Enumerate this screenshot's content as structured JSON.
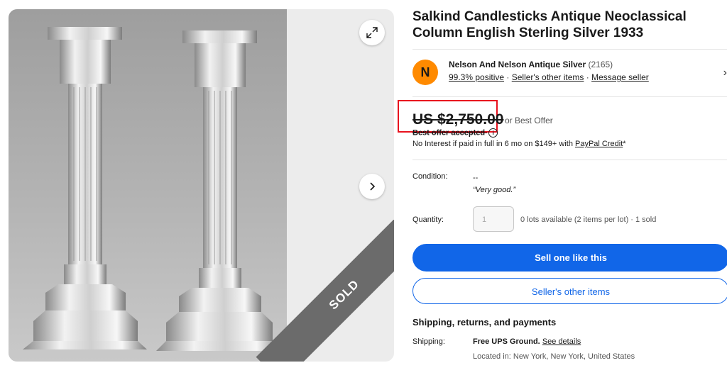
{
  "listing": {
    "title": "Salkind Candlesticks Antique Neoclassical Column English Sterling Silver 1933",
    "sold_badge": "SOLD"
  },
  "seller": {
    "avatar_initial": "N",
    "name": "Nelson And Nelson Antique Silver",
    "feedback_count": "(2165)",
    "positive": "99.3% positive",
    "other_items_link": "Seller's other items",
    "message_link": "Message seller",
    "separator": "·"
  },
  "price": {
    "amount": "US $2,750.00",
    "best_offer": "or Best Offer",
    "offer_accepted": "Best offer accepted",
    "financing_text": "No Interest if paid in full in 6 mo on $149+ with",
    "financing_link": "PayPal Credit",
    "financing_suffix": "*"
  },
  "condition": {
    "label": "Condition:",
    "value": "--",
    "note": "“Very good.”"
  },
  "quantity": {
    "label": "Quantity:",
    "value": "1",
    "availability": "0 lots available (2 items per lot) · 1 sold"
  },
  "actions": {
    "primary": "Sell one like this",
    "secondary": "Seller's other items"
  },
  "shipping": {
    "heading": "Shipping, returns, and payments",
    "label": "Shipping:",
    "method": "Free UPS Ground.",
    "details_link": "See details",
    "location": "Located in: New York, New York, United States"
  },
  "icons": {
    "expand": "expand-icon",
    "next": "chevron-right-icon",
    "seller_chevron": "chevron-right-icon",
    "info": "info-icon"
  },
  "colors": {
    "primary_blue": "#1166e8",
    "highlight_red": "#e8121e",
    "avatar_orange": "#ff8a00",
    "sold_band": "#6b6b6b"
  }
}
